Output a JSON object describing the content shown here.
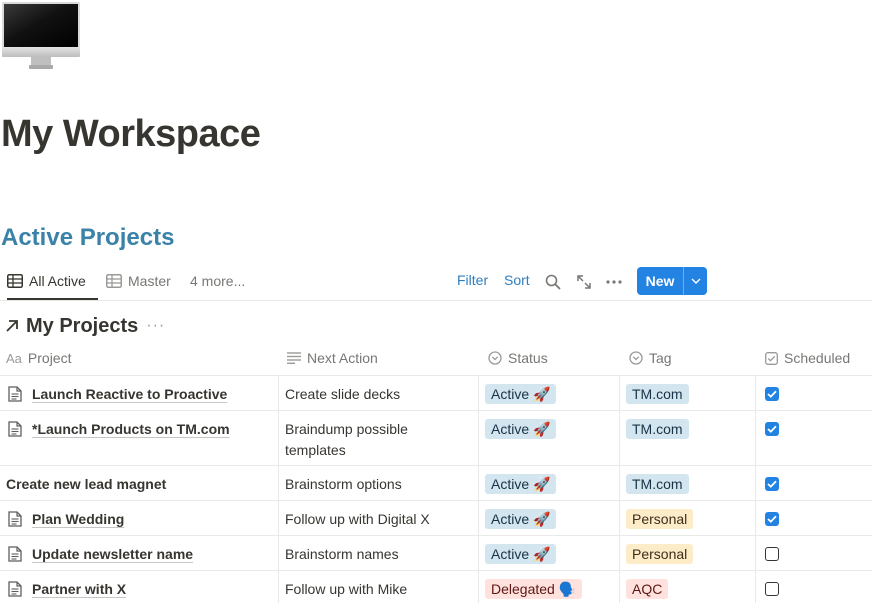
{
  "page": {
    "icon": "imac-icon",
    "title": "My Workspace"
  },
  "section": {
    "title": "Active Projects"
  },
  "views": {
    "tabs": [
      {
        "label": "All Active",
        "icon": "table-icon",
        "active": true
      },
      {
        "label": "Master",
        "icon": "table-icon",
        "active": false
      }
    ],
    "more_label": "4 more...",
    "filter_label": "Filter",
    "sort_label": "Sort",
    "new_label": "New"
  },
  "database": {
    "title": "My Projects",
    "dots": "···",
    "columns": [
      {
        "label": "Project",
        "icon": "Aa"
      },
      {
        "label": "Next Action",
        "icon": "text-lines-icon"
      },
      {
        "label": "Status",
        "icon": "select-icon"
      },
      {
        "label": "Tag",
        "icon": "select-icon"
      },
      {
        "label": "Scheduled",
        "icon": "checkbox-icon"
      }
    ],
    "rows": [
      {
        "project": "Launch Reactive to Proactive",
        "has_doc": true,
        "next_action": "Create slide decks",
        "status": "Active 🚀",
        "tag": "TM.com",
        "scheduled": true
      },
      {
        "project": "*Launch Products on TM.com",
        "has_doc": true,
        "next_action": "Braindump possible templates",
        "status": "Active 🚀",
        "tag": "TM.com",
        "scheduled": true
      },
      {
        "project": "Create new lead magnet",
        "has_doc": false,
        "next_action": "Brainstorm options",
        "status": "Active 🚀",
        "tag": "TM.com",
        "scheduled": true
      },
      {
        "project": "Plan Wedding",
        "has_doc": true,
        "next_action": "Follow up with Digital X",
        "status": "Active 🚀",
        "tag": "Personal",
        "scheduled": true
      },
      {
        "project": "Update newsletter name",
        "has_doc": true,
        "next_action": "Brainstorm names",
        "status": "Active 🚀",
        "tag": "Personal",
        "scheduled": false
      },
      {
        "project": "Partner with X",
        "has_doc": true,
        "next_action": "Follow up with Mike",
        "status": "Delegated 🗣️",
        "tag": "AQC",
        "scheduled": false
      }
    ]
  },
  "colors": {
    "accent": "#2383e2",
    "section_title": "#3b82a8",
    "pill_blue": "#d3e5ef",
    "pill_red": "#ffe2dd",
    "pill_yellow": "#fdecc8"
  }
}
